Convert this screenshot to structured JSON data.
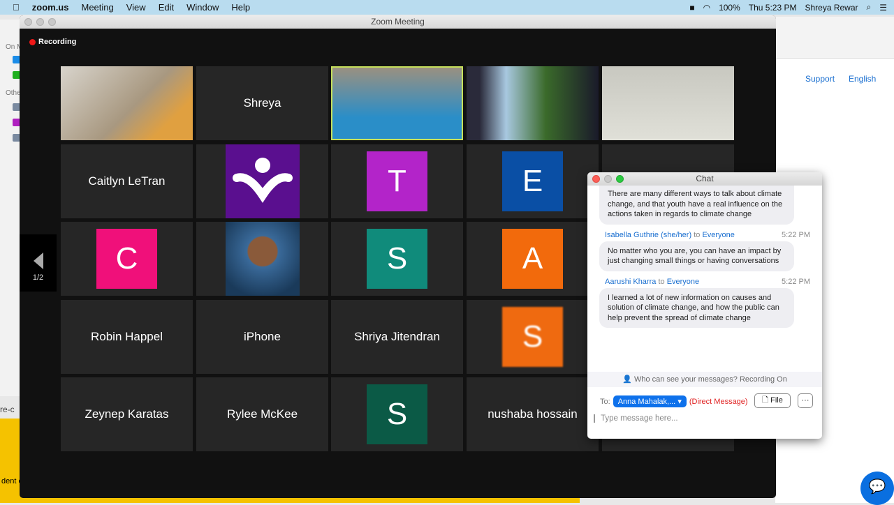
{
  "menubar": {
    "app": "zoom.us",
    "items": [
      "Meeting",
      "View",
      "Edit",
      "Window",
      "Help"
    ],
    "battery": "100%",
    "clock": "Thu 5:23 PM",
    "user": "Shreya Rewar"
  },
  "background": {
    "left_labels": [
      "On M",
      "Othe"
    ],
    "url_fragment": "re-c",
    "yellow_text": "dent e",
    "support": "Support",
    "language": "English"
  },
  "window": {
    "title": "Zoom Meeting",
    "recording": "Recording",
    "page": "1/2"
  },
  "tiles": [
    {
      "type": "video",
      "desc": ""
    },
    {
      "type": "name",
      "name": "Shreya"
    },
    {
      "type": "video",
      "active": true
    },
    {
      "type": "video"
    },
    {
      "type": "video"
    },
    {
      "type": "name",
      "name": "Caitlyn LeTran"
    },
    {
      "type": "logo",
      "color": "#5a0f8f"
    },
    {
      "type": "avatar",
      "letter": "T",
      "color": "#b324c9"
    },
    {
      "type": "avatar",
      "letter": "E",
      "color": "#0a4fa5"
    },
    {
      "type": "blank"
    },
    {
      "type": "avatar",
      "letter": "C",
      "color": "#f0107a"
    },
    {
      "type": "photo"
    },
    {
      "type": "avatar",
      "letter": "S",
      "color": "#108b7b"
    },
    {
      "type": "avatar",
      "letter": "A",
      "color": "#f26a0c"
    },
    {
      "type": "blank"
    },
    {
      "type": "name",
      "name": "Robin Happel"
    },
    {
      "type": "name",
      "name": "iPhone"
    },
    {
      "type": "name",
      "name": "Shriya Jitendran"
    },
    {
      "type": "avatar",
      "letter": "S",
      "color": "#ef6a10"
    },
    {
      "type": "blank"
    },
    {
      "type": "name",
      "name": "Zeynep Karatas"
    },
    {
      "type": "name",
      "name": "Rylee McKee"
    },
    {
      "type": "avatar",
      "letter": "S",
      "color": "#0b5a46"
    },
    {
      "type": "name",
      "name": "nushaba hossain"
    },
    {
      "type": "blank"
    }
  ],
  "chat": {
    "title": "Chat",
    "first_message": "There are many different ways to talk about climate change, and that youth have a real influence on the actions taken in regards to climate change",
    "messages": [
      {
        "sender": "Isabella Guthrie (she/her)",
        "to_word": "to",
        "recipient": "Everyone",
        "time": "5:22 PM",
        "text": "No matter who you are, you can have an impact by just changing small things or having conversations"
      },
      {
        "sender": "Aarushi Kharra",
        "to_word": "to",
        "recipient": "Everyone",
        "time": "5:22 PM",
        "text": "I learned a lot of new information on causes and solution of climate change, and how the public can help prevent the spread of climate change"
      }
    ],
    "privacy_note": "Who can see your messages? Recording On",
    "to_label": "To:",
    "to_value": "Anna Mahalak,...",
    "direct": "(Direct Message)",
    "file": "File",
    "more": "···",
    "placeholder": "Type message here..."
  }
}
